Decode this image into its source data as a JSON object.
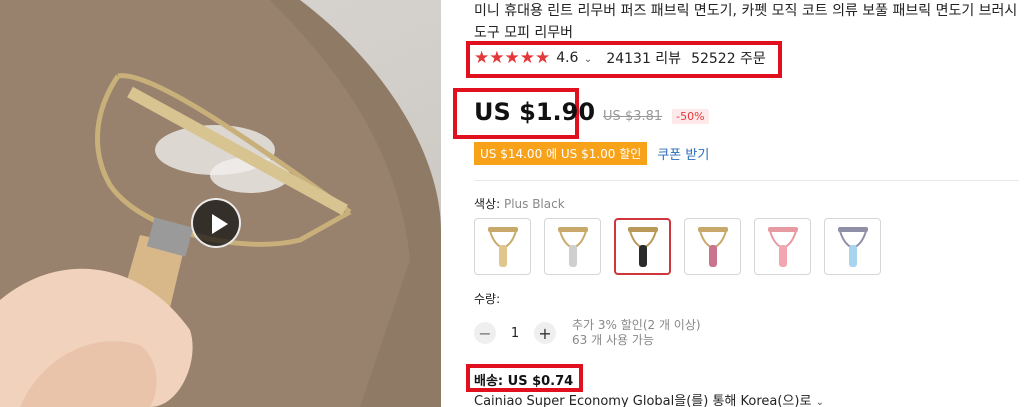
{
  "product": {
    "title": "미니 휴대용 린트 리무버 퍼즈 패브릭 면도기, 카펫 모직 코트 의류 보풀 패브릭 면도기 브러시 도구 모피 리무버"
  },
  "rating": {
    "stars": "★★★★★",
    "score": "4.6",
    "chevron": "⌄",
    "reviews": "24131 리뷰",
    "orders": "52522 주문"
  },
  "price": {
    "current": "US $1.90",
    "original": "US $3.81",
    "discount": "-50%"
  },
  "coupon": {
    "badge": "US $14.00 에 US $1.00 할인",
    "link": "쿠폰 받기"
  },
  "color": {
    "label": "색상:",
    "selected": "Plus Black",
    "options": [
      {
        "name": "gold-wood",
        "handle": "#e2c48d",
        "frame": "#c9a96a"
      },
      {
        "name": "gold-silver",
        "handle": "#cfcfcf",
        "frame": "#c9a96a"
      },
      {
        "name": "plus-black",
        "handle": "#2b2b2b",
        "frame": "#b89958"
      },
      {
        "name": "gold-pink",
        "handle": "#c9748e",
        "frame": "#c9a96a"
      },
      {
        "name": "pink",
        "handle": "#f2a7b0",
        "frame": "#e79aa2"
      },
      {
        "name": "blue",
        "handle": "#a9d4ee",
        "frame": "#8f8fa8"
      }
    ],
    "selected_index": 2
  },
  "quantity": {
    "label": "수량:",
    "minus": "−",
    "plus": "+",
    "value": "1",
    "discount_note": "추가 3% 할인(2 개 이상)",
    "available": "63 개 사용 가능"
  },
  "shipping": {
    "fee": "배송: US $0.74",
    "method": "Cainiao Super Economy Global을(를) 통해 Korea(으)로",
    "chevron": "⌄"
  },
  "colors": {
    "accent_red": "#e0101f",
    "star_red": "#e5383b",
    "coupon_orange": "#f8a21a",
    "link_blue": "#2a6ebb"
  }
}
